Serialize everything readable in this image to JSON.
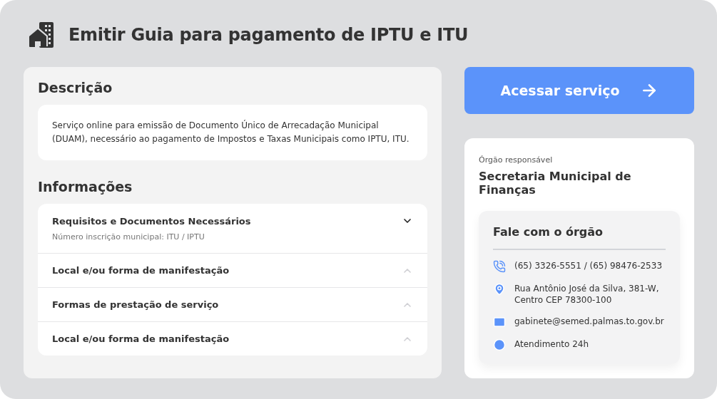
{
  "header": {
    "title": "Emitir Guia para pagamento de IPTU e ITU"
  },
  "description": {
    "heading": "Descrição",
    "text": "Serviço online para emissão de Documento Único de Arrecadação Municipal (DUAM), necessário ao pagamento de Impostos e Taxas Municipais como IPTU, ITU."
  },
  "information": {
    "heading": "Informações",
    "items": [
      {
        "label": "Requisitos e Documentos Necessários",
        "expanded": true,
        "detail": "Número inscrição municipal: ITU / IPTU"
      },
      {
        "label": "Local e/ou forma de manifestação",
        "expanded": false
      },
      {
        "label": "Formas de prestação de serviço",
        "expanded": false
      },
      {
        "label": "Local e/ou forma de manifestação",
        "expanded": false
      }
    ]
  },
  "access_button": {
    "label": "Acessar serviço"
  },
  "agency": {
    "caption": "Órgão responsável",
    "name": "Secretaria Municipal de Finanças",
    "contact": {
      "heading": "Fale com o órgão",
      "items": [
        {
          "kind": "phone",
          "text": "(65) 3326-5551 / (65) 98476-2533"
        },
        {
          "kind": "address",
          "text": "Rua Antônio José da Silva, 381-W, Centro CEP 78300-100"
        },
        {
          "kind": "email",
          "text": "gabinete@semed.palmas.to.gov.br"
        },
        {
          "kind": "hours",
          "text": "Atendimento 24h"
        }
      ]
    }
  }
}
